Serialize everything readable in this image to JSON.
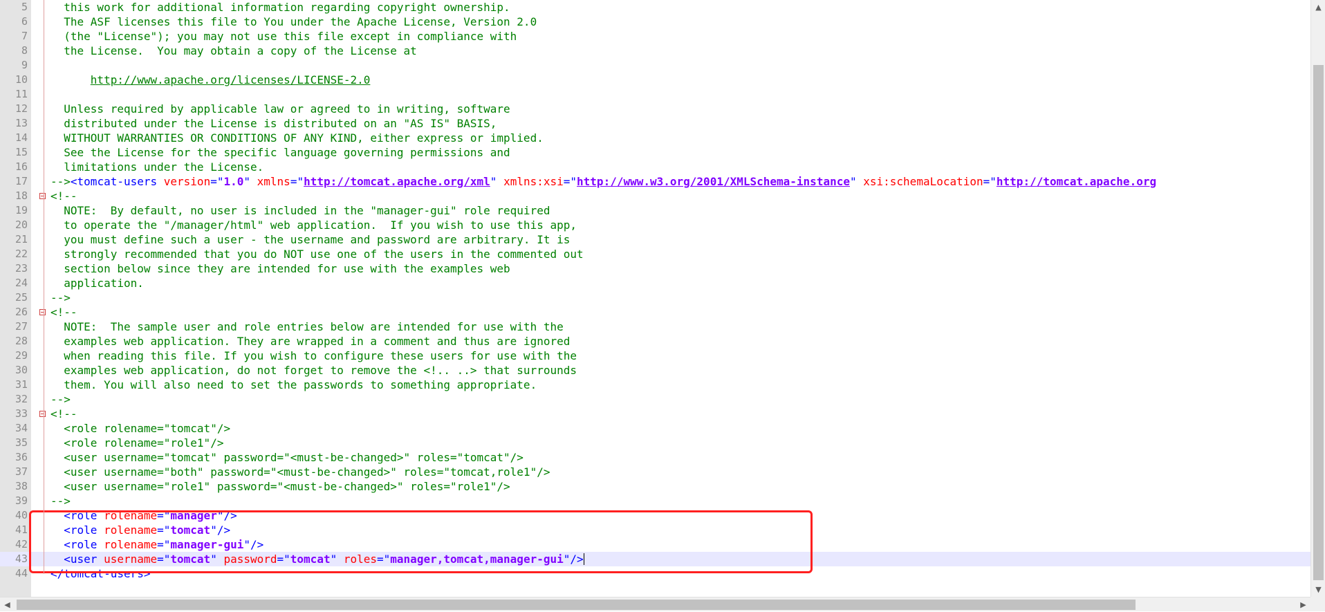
{
  "colors": {
    "comment": "#008000",
    "tag": "#0000ff",
    "attribute": "#ff0000",
    "value": "#8000ff",
    "highlight_box": "#ff2020",
    "current_line": "#e8e8ff"
  },
  "icons": {
    "fold": "fold-minus-icon",
    "scroll_up": "arrow-up-icon",
    "scroll_down": "arrow-down-icon",
    "scroll_left": "arrow-left-icon",
    "scroll_right": "arrow-right-icon"
  },
  "editor": {
    "current_line": 43,
    "lines": [
      {
        "n": "5",
        "segs": [
          {
            "k": "c",
            "t": "  this work for additional information regarding copyright ownership."
          }
        ]
      },
      {
        "n": "6",
        "segs": [
          {
            "k": "c",
            "t": "  The ASF licenses this file to You under the Apache License, Version 2.0"
          }
        ]
      },
      {
        "n": "7",
        "segs": [
          {
            "k": "c",
            "t": "  (the \"License\"); you may not use this file except in compliance with"
          }
        ]
      },
      {
        "n": "8",
        "segs": [
          {
            "k": "c",
            "t": "  the License.  You may obtain a copy of the License at"
          }
        ]
      },
      {
        "n": "9",
        "segs": []
      },
      {
        "n": "10",
        "segs": [
          {
            "k": "c",
            "t": "      "
          },
          {
            "k": "u",
            "t": "http://www.apache.org/licenses/LICENSE-2.0"
          }
        ]
      },
      {
        "n": "11",
        "segs": []
      },
      {
        "n": "12",
        "segs": [
          {
            "k": "c",
            "t": "  Unless required by applicable law or agreed to in writing, software"
          }
        ]
      },
      {
        "n": "13",
        "segs": [
          {
            "k": "c",
            "t": "  distributed under the License is distributed on an \"AS IS\" BASIS,"
          }
        ]
      },
      {
        "n": "14",
        "segs": [
          {
            "k": "c",
            "t": "  WITHOUT WARRANTIES OR CONDITIONS OF ANY KIND, either express or implied."
          }
        ]
      },
      {
        "n": "15",
        "segs": [
          {
            "k": "c",
            "t": "  See the License for the specific language governing permissions and"
          }
        ]
      },
      {
        "n": "16",
        "segs": [
          {
            "k": "c",
            "t": "  limitations under the License."
          }
        ]
      },
      {
        "n": "17",
        "segs": [
          {
            "k": "c",
            "t": "-->"
          },
          {
            "k": "t",
            "t": "<tomcat-users "
          },
          {
            "k": "a",
            "t": "version"
          },
          {
            "k": "t",
            "t": "=\""
          },
          {
            "k": "v",
            "t": "1.0"
          },
          {
            "k": "t",
            "t": "\" "
          },
          {
            "k": "a",
            "t": "xmlns"
          },
          {
            "k": "t",
            "t": "=\""
          },
          {
            "k": "vu",
            "t": "http://tomcat.apache.org/xml"
          },
          {
            "k": "t",
            "t": "\" "
          },
          {
            "k": "a",
            "t": "xmlns:xsi"
          },
          {
            "k": "t",
            "t": "=\""
          },
          {
            "k": "vu",
            "t": "http://www.w3.org/2001/XMLSchema-instance"
          },
          {
            "k": "t",
            "t": "\" "
          },
          {
            "k": "a",
            "t": "xsi:schemaLocation"
          },
          {
            "k": "t",
            "t": "=\""
          },
          {
            "k": "vu",
            "t": "http://tomcat.apache.org"
          }
        ]
      },
      {
        "n": "18",
        "segs": [
          {
            "k": "c",
            "t": "<!--"
          }
        ]
      },
      {
        "n": "19",
        "segs": [
          {
            "k": "c",
            "t": "  NOTE:  By default, no user is included in the \"manager-gui\" role required"
          }
        ]
      },
      {
        "n": "20",
        "segs": [
          {
            "k": "c",
            "t": "  to operate the \"/manager/html\" web application.  If you wish to use this app,"
          }
        ]
      },
      {
        "n": "21",
        "segs": [
          {
            "k": "c",
            "t": "  you must define such a user - the username and password are arbitrary. It is"
          }
        ]
      },
      {
        "n": "22",
        "segs": [
          {
            "k": "c",
            "t": "  strongly recommended that you do NOT use one of the users in the commented out"
          }
        ]
      },
      {
        "n": "23",
        "segs": [
          {
            "k": "c",
            "t": "  section below since they are intended for use with the examples web"
          }
        ]
      },
      {
        "n": "24",
        "segs": [
          {
            "k": "c",
            "t": "  application."
          }
        ]
      },
      {
        "n": "25",
        "segs": [
          {
            "k": "c",
            "t": "-->"
          }
        ]
      },
      {
        "n": "26",
        "segs": [
          {
            "k": "c",
            "t": "<!--"
          }
        ]
      },
      {
        "n": "27",
        "segs": [
          {
            "k": "c",
            "t": "  NOTE:  The sample user and role entries below are intended for use with the"
          }
        ]
      },
      {
        "n": "28",
        "segs": [
          {
            "k": "c",
            "t": "  examples web application. They are wrapped in a comment and thus are ignored"
          }
        ]
      },
      {
        "n": "29",
        "segs": [
          {
            "k": "c",
            "t": "  when reading this file. If you wish to configure these users for use with the"
          }
        ]
      },
      {
        "n": "30",
        "segs": [
          {
            "k": "c",
            "t": "  examples web application, do not forget to remove the <!.. ..> that surrounds"
          }
        ]
      },
      {
        "n": "31",
        "segs": [
          {
            "k": "c",
            "t": "  them. You will also need to set the passwords to something appropriate."
          }
        ]
      },
      {
        "n": "32",
        "segs": [
          {
            "k": "c",
            "t": "-->"
          }
        ]
      },
      {
        "n": "33",
        "segs": [
          {
            "k": "c",
            "t": "<!--"
          }
        ]
      },
      {
        "n": "34",
        "segs": [
          {
            "k": "c",
            "t": "  <role rolename=\"tomcat\"/>"
          }
        ]
      },
      {
        "n": "35",
        "segs": [
          {
            "k": "c",
            "t": "  <role rolename=\"role1\"/>"
          }
        ]
      },
      {
        "n": "36",
        "segs": [
          {
            "k": "c",
            "t": "  <user username=\"tomcat\" password=\"<must-be-changed>\" roles=\"tomcat\"/>"
          }
        ]
      },
      {
        "n": "37",
        "segs": [
          {
            "k": "c",
            "t": "  <user username=\"both\" password=\"<must-be-changed>\" roles=\"tomcat,role1\"/>"
          }
        ]
      },
      {
        "n": "38",
        "segs": [
          {
            "k": "c",
            "t": "  <user username=\"role1\" password=\"<must-be-changed>\" roles=\"role1\"/>"
          }
        ]
      },
      {
        "n": "39",
        "segs": [
          {
            "k": "c",
            "t": "-->"
          }
        ]
      },
      {
        "n": "40",
        "segs": [
          {
            "k": "t",
            "t": "  <role "
          },
          {
            "k": "a",
            "t": "rolename"
          },
          {
            "k": "t",
            "t": "=\""
          },
          {
            "k": "v",
            "t": "manager"
          },
          {
            "k": "t",
            "t": "\"/>"
          }
        ]
      },
      {
        "n": "41",
        "segs": [
          {
            "k": "t",
            "t": "  <role "
          },
          {
            "k": "a",
            "t": "rolename"
          },
          {
            "k": "t",
            "t": "=\""
          },
          {
            "k": "v",
            "t": "tomcat"
          },
          {
            "k": "t",
            "t": "\"/>"
          }
        ]
      },
      {
        "n": "42",
        "segs": [
          {
            "k": "t",
            "t": "  <role "
          },
          {
            "k": "a",
            "t": "rolename"
          },
          {
            "k": "t",
            "t": "=\""
          },
          {
            "k": "v",
            "t": "manager-gui"
          },
          {
            "k": "t",
            "t": "\"/>"
          }
        ]
      },
      {
        "n": "43",
        "segs": [
          {
            "k": "t",
            "t": "  <user "
          },
          {
            "k": "a",
            "t": "username"
          },
          {
            "k": "t",
            "t": "=\""
          },
          {
            "k": "v",
            "t": "tomcat"
          },
          {
            "k": "t",
            "t": "\" "
          },
          {
            "k": "a",
            "t": "password"
          },
          {
            "k": "t",
            "t": "=\""
          },
          {
            "k": "v",
            "t": "tomcat"
          },
          {
            "k": "t",
            "t": "\" "
          },
          {
            "k": "a",
            "t": "roles"
          },
          {
            "k": "t",
            "t": "=\""
          },
          {
            "k": "v",
            "t": "manager,tomcat,manager-gui"
          },
          {
            "k": "t",
            "t": "\"/>"
          }
        ]
      },
      {
        "n": "44",
        "segs": [
          {
            "k": "t",
            "t": "</tomcat-users>"
          }
        ]
      }
    ]
  }
}
